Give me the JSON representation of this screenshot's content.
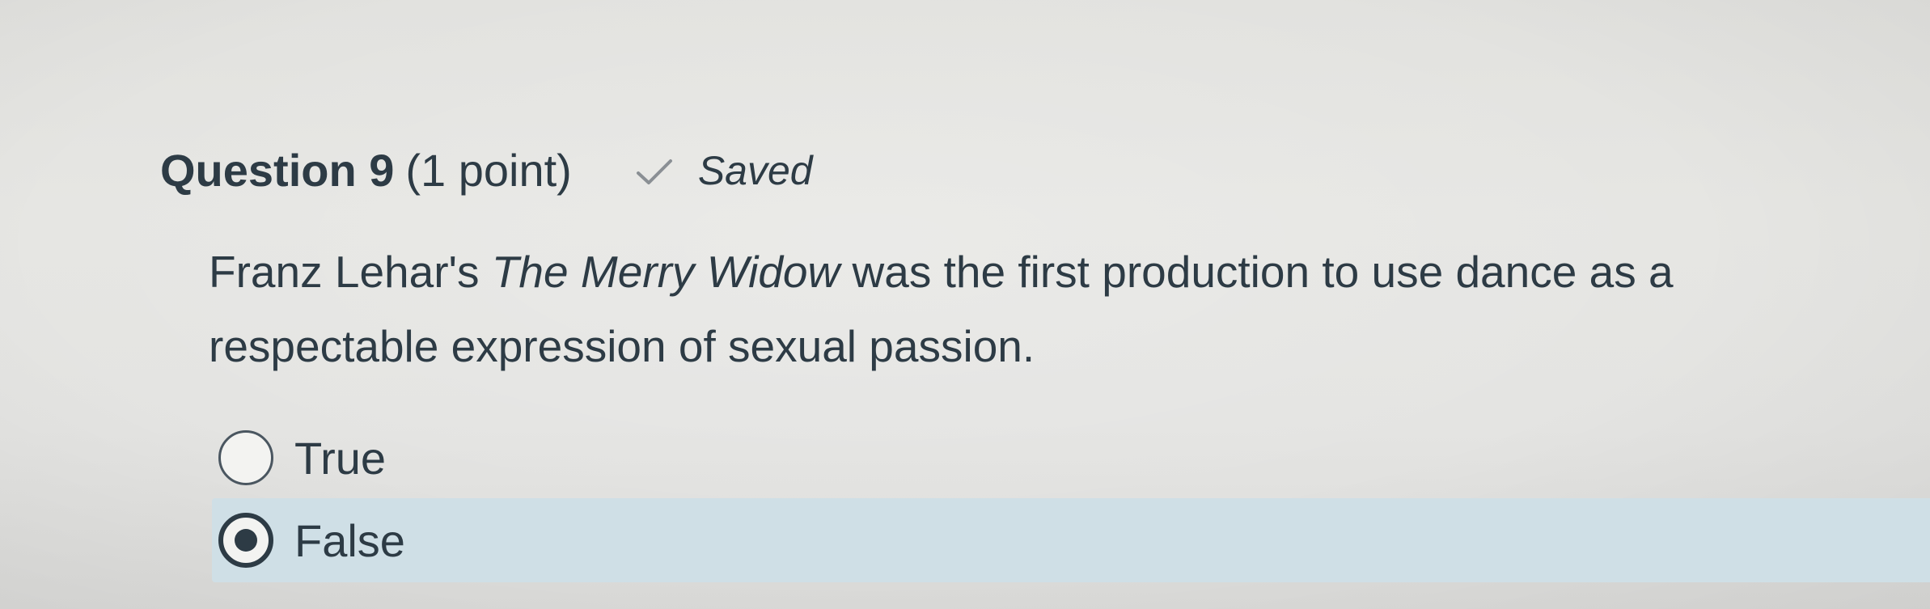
{
  "question": {
    "title": "Question 9",
    "points": "(1 point)",
    "status": {
      "icon": "checkmark-icon",
      "text": "Saved"
    },
    "text": {
      "before": "Franz Lehar's ",
      "italic": "The Merry Widow",
      "after": " was the first production to use dance as a respectable expression of sexual passion."
    }
  },
  "answers": [
    {
      "label": "True",
      "selected": false
    },
    {
      "label": "False",
      "selected": true
    }
  ],
  "colors": {
    "text": "#2d3b45",
    "selected_row": "#cfdfe6",
    "check": "#8a8f94"
  }
}
